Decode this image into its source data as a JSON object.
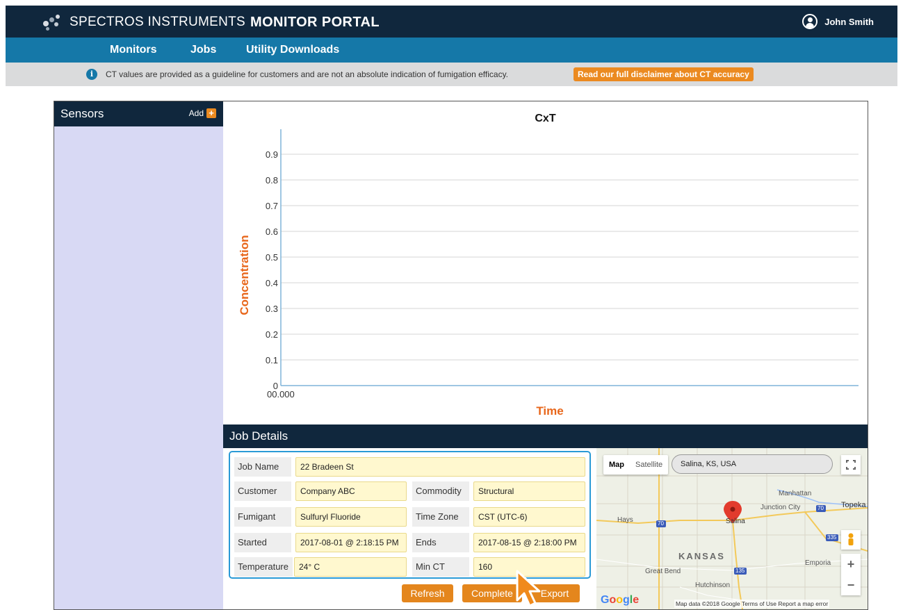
{
  "header": {
    "brand_light": "SPECTROS INSTRUMENTS",
    "brand_bold": "MONITOR PORTAL",
    "user_name": "John Smith"
  },
  "nav": {
    "items": [
      {
        "label": "Monitors"
      },
      {
        "label": "Jobs"
      },
      {
        "label": "Utility Downloads"
      }
    ]
  },
  "notice": {
    "text": "CT values are provided as a guideline for customers and are not an absolute indication of fumigation efficacy.",
    "link_label": "Read our full disclaimer about CT accuracy"
  },
  "sidebar": {
    "title": "Sensors",
    "add_label": "Add",
    "add_icon": "+"
  },
  "chart_data": {
    "type": "line",
    "title": "CxT",
    "xlabel": "Time",
    "ylabel": "Concentration",
    "y_ticks": [
      "0.9",
      "0.8",
      "0.7",
      "0.6",
      "0.5",
      "0.4",
      "0.3",
      "0.2",
      "0.1",
      "0"
    ],
    "x_ticks": [
      "00.000"
    ],
    "ylim": [
      0,
      1
    ],
    "series": [],
    "grid": true,
    "colors": {
      "axis_label": "#e8661a",
      "axis": "#7fb4d8",
      "grid": "#d6d6d6"
    }
  },
  "job_details": {
    "title": "Job Details",
    "fields": {
      "job_name": {
        "label": "Job Name",
        "value": "22 Bradeen St"
      },
      "customer": {
        "label": "Customer",
        "value": "Company ABC"
      },
      "commodity": {
        "label": "Commodity",
        "value": "Structural"
      },
      "fumigant": {
        "label": "Fumigant",
        "value": "Sulfuryl Fluoride"
      },
      "time_zone": {
        "label": "Time Zone",
        "value": "CST (UTC-6)"
      },
      "started": {
        "label": "Started",
        "value": "2017-08-01 @ 2:18:15 PM"
      },
      "ends": {
        "label": "Ends",
        "value": "2017-08-15 @ 2:18:00 PM"
      },
      "temperature": {
        "label": "Temperature",
        "value": "24° C"
      },
      "min_ct": {
        "label": "Min CT",
        "value": "160"
      }
    },
    "buttons": {
      "refresh": "Refresh",
      "complete": "Complete",
      "export": "Export"
    }
  },
  "map": {
    "type_map": "Map",
    "type_satellite": "Satellite",
    "search_value": "Salina, KS, USA",
    "labels": {
      "manhattan": "Manhattan",
      "junction_city": "Junction City",
      "topeka": "Topeka",
      "hays": "Hays",
      "salina": "Salina",
      "kansas": "KANSAS",
      "emporia": "Emporia",
      "great_bend": "Great Bend",
      "hutchinson": "Hutchinson"
    },
    "shields": {
      "i70_a": "70",
      "i70_b": "70",
      "i135": "135",
      "i335": "335"
    },
    "zoom_in": "+",
    "zoom_out": "−",
    "google": "Google",
    "footer": "Map data ©2018 Google   Terms of Use   Report a map error"
  }
}
